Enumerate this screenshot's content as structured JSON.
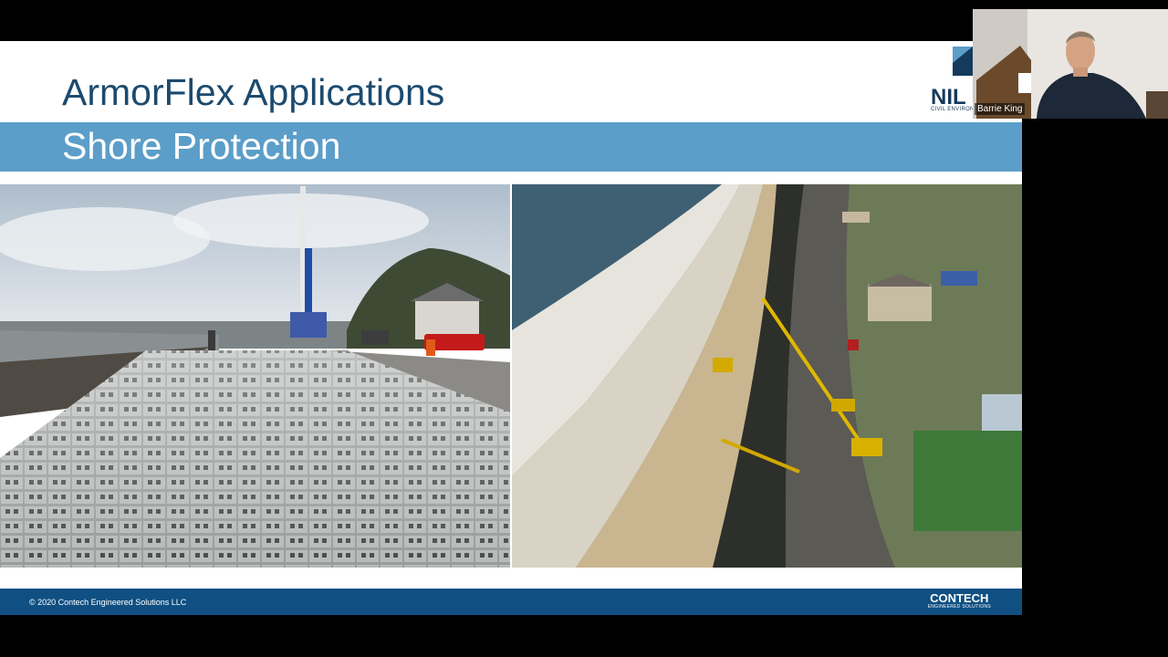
{
  "slide": {
    "title": "ArmorFlex Applications",
    "subtitle": "Shore Protection",
    "logo_text": "NIL",
    "logo_small": "CIVIL ENVIRONME",
    "footer_copyright": "© 2020 Contech Engineered Solutions LLC",
    "footer_brand": "CONTECH",
    "footer_brand_sub": "ENGINEERED SOLUTIONS"
  },
  "participant": {
    "name": "Barrie King"
  },
  "colors": {
    "title": "#1c4a6e",
    "subtitle_bar": "#5b9ec9",
    "footer": "#0f4f82"
  }
}
